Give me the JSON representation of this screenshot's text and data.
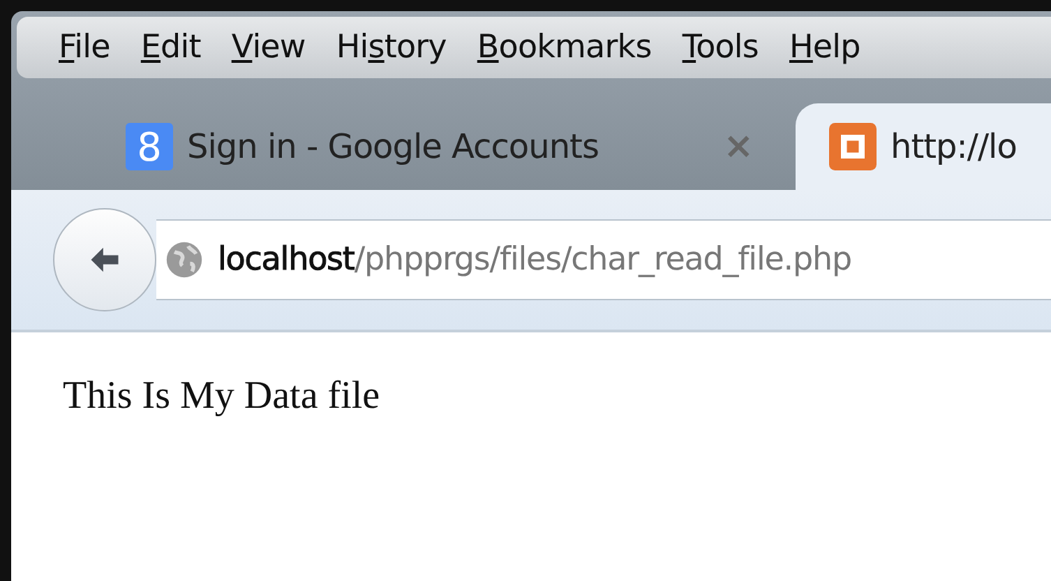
{
  "menu": [
    {
      "key": "F",
      "post": "ile"
    },
    {
      "key": "E",
      "post": "dit"
    },
    {
      "key": "V",
      "post": "iew"
    },
    {
      "pre": "Hi",
      "key": "s",
      "post": "tory"
    },
    {
      "key": "B",
      "post": "ookmarks"
    },
    {
      "key": "T",
      "post": "ools"
    },
    {
      "key": "H",
      "post": "elp"
    }
  ],
  "tabs": [
    {
      "title": "Sign in - Google Accounts",
      "icon_text": "8",
      "close": "×",
      "selected": false
    },
    {
      "title": "http://lo",
      "selected": true
    }
  ],
  "address": {
    "url": "**localhost**/phpprgs/files/char_read_file.php"
  },
  "page": {
    "text": "This Is My Data file"
  }
}
